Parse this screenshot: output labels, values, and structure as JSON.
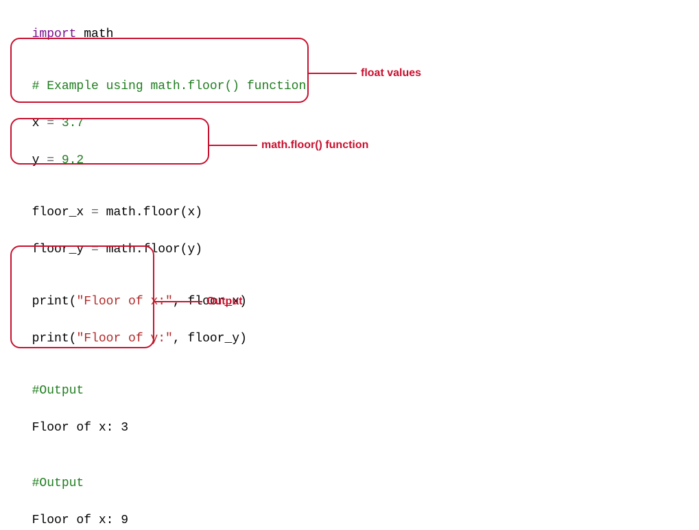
{
  "code": {
    "l1": {
      "kw": "import",
      "mod": " math"
    },
    "block1": {
      "comment": "# Example using math.floor() function",
      "x_line": {
        "var": "x",
        "eq": " = ",
        "val": "3.7"
      },
      "y_line": {
        "var": "y",
        "eq": " = ",
        "val": "9.2"
      }
    },
    "block2": {
      "fx": {
        "lhs": "floor_x",
        "eq": " = ",
        "call": "math.floor(x)"
      },
      "fy": {
        "lhs": "floor_y",
        "eq": " = ",
        "call": "math.floor(y)"
      }
    },
    "prints": {
      "p1": {
        "fn": "print",
        "open": "(",
        "str": "\"Floor of x:\"",
        "rest": ", floor_x)"
      },
      "p2": {
        "fn": "print",
        "open": "(",
        "str": "\"Floor of y:\"",
        "rest": ", floor_y)"
      }
    },
    "output": {
      "c1": "#Output",
      "r1": "Floor of x: 3",
      "c2": "#Output",
      "r2": "Floor of x: 9"
    }
  },
  "annotations": {
    "a1": "float values",
    "a2": "math.floor() function",
    "a3": "Output"
  }
}
